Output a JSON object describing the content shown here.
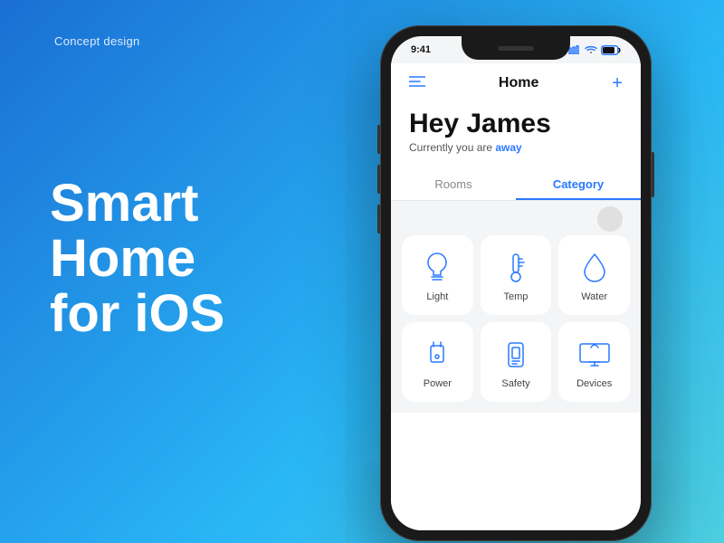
{
  "background": {
    "label": "Concept design"
  },
  "hero": {
    "line1": "Smart",
    "line2": "Home",
    "line3": "for iOS"
  },
  "phone": {
    "status_bar": {
      "time": "9:41",
      "signal": "●●●",
      "wifi": "WiFi",
      "battery": "🔋"
    },
    "header": {
      "title": "Home",
      "plus": "+"
    },
    "greeting": {
      "name": "Hey James",
      "status_prefix": "Currently you are ",
      "status_value": "away"
    },
    "tabs": [
      {
        "label": "Rooms",
        "active": false
      },
      {
        "label": "Category",
        "active": true
      }
    ],
    "grid_items": [
      {
        "id": "light",
        "label": "Light"
      },
      {
        "id": "temp",
        "label": "Temp"
      },
      {
        "id": "water",
        "label": "Water"
      },
      {
        "id": "power",
        "label": "Power"
      },
      {
        "id": "safety",
        "label": "Safety"
      },
      {
        "id": "devices",
        "label": "Devices"
      }
    ]
  }
}
